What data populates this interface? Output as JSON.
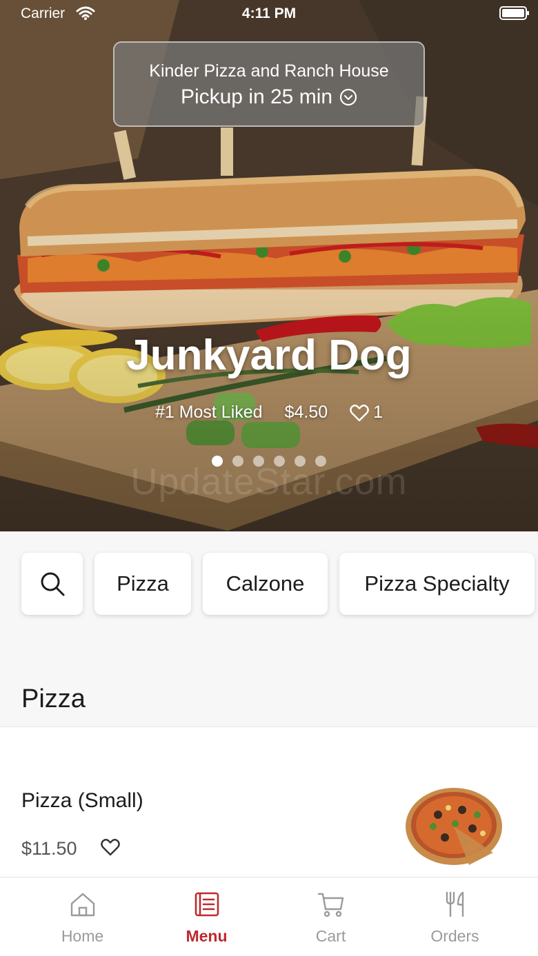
{
  "status_bar": {
    "carrier": "Carrier",
    "time": "4:11 PM",
    "wifi_icon": "wifi-icon",
    "battery_icon": "battery-icon"
  },
  "store": {
    "name": "Kinder Pizza and Ranch House",
    "pickup": "Pickup in 25 min",
    "pickup_icon": "chevron-down-circle-icon"
  },
  "hero": {
    "title": "Junkyard Dog",
    "rank": "#1 Most Liked",
    "price": "$4.50",
    "likes": "1",
    "slide_count": 6,
    "active_slide": 1,
    "watermark": "UpdateStar.com"
  },
  "categories": {
    "search_icon": "search-icon",
    "items": [
      "Pizza",
      "Calzone",
      "Pizza Specialty"
    ]
  },
  "section": {
    "title": "Pizza"
  },
  "menu_items": [
    {
      "name": "Pizza (Small)",
      "price": "$11.50",
      "favorite_icon": "heart-outline-icon"
    }
  ],
  "tabs": [
    {
      "label": "Home",
      "icon": "home-icon",
      "active": false
    },
    {
      "label": "Menu",
      "icon": "menu-book-icon",
      "active": true
    },
    {
      "label": "Cart",
      "icon": "cart-icon",
      "active": false
    },
    {
      "label": "Orders",
      "icon": "fork-knife-icon",
      "active": false
    }
  ],
  "colors": {
    "accent": "#c0282d",
    "tab_inactive": "#9a9a9a",
    "background": "#f7f7f7"
  }
}
